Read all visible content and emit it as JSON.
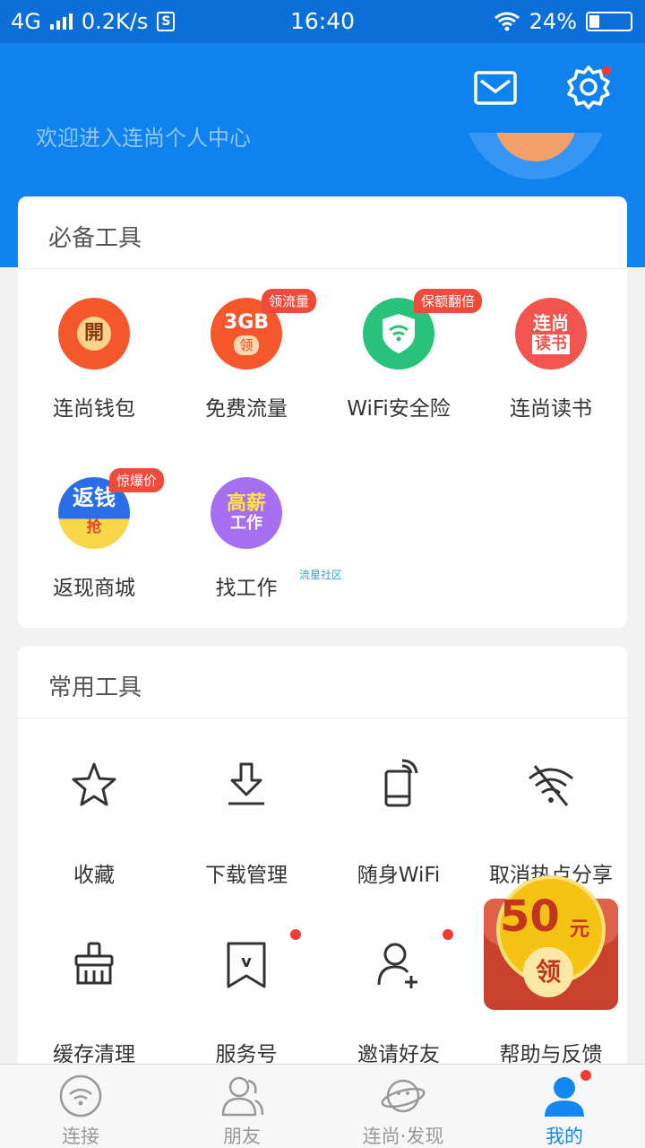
{
  "status_bar": {
    "network": "4G",
    "speed": "0.2K/s",
    "sim": "S",
    "time": "16:40",
    "battery": "24%",
    "battery_level": 0.24
  },
  "header": {
    "welcome": "欢迎进入连尚个人中心",
    "icons": [
      "mail-icon",
      "gear-icon"
    ],
    "colors": {
      "header_bg": "#0f82f0",
      "status_bg": "#0c6fd9"
    }
  },
  "essential_tools": {
    "title": "必备工具",
    "items": [
      {
        "label": "连尚钱包",
        "icon_text": "開",
        "tag": ""
      },
      {
        "label": "免费流量",
        "icon_text": "3GB",
        "icon_sub": "领",
        "tag": "领流量"
      },
      {
        "label": "WiFi安全险",
        "icon_text": "",
        "tag": "保额翻倍"
      },
      {
        "label": "连尚读书",
        "icon_text": "连尚",
        "icon_sub": "读书",
        "tag": ""
      },
      {
        "label": "返现商城",
        "icon_text": "返钱",
        "icon_sub": "抢",
        "tag": "惊爆价"
      },
      {
        "label": "找工作",
        "icon_text": "高薪",
        "icon_sub": "工作",
        "tag": ""
      }
    ]
  },
  "watermark": "流星社区",
  "common_tools": {
    "title": "常用工具",
    "items": [
      {
        "label": "收藏",
        "icon": "star-icon"
      },
      {
        "label": "下载管理",
        "icon": "download-icon"
      },
      {
        "label": "随身WiFi",
        "icon": "phone-wifi-icon"
      },
      {
        "label": "取消热点分享",
        "icon": "wifi-off-icon"
      },
      {
        "label": "缓存清理",
        "icon": "brush-icon"
      },
      {
        "label": "服务号",
        "icon": "service-icon",
        "icon_text": "v"
      },
      {
        "label": "邀请好友",
        "icon": "add-user-icon"
      },
      {
        "label": "帮助与反馈",
        "icon": "help-icon"
      }
    ]
  },
  "promo": {
    "amount": "50",
    "unit": "元",
    "action": "领"
  },
  "tabs": [
    {
      "label": "连接",
      "icon": "wifi-icon"
    },
    {
      "label": "朋友",
      "icon": "friends-icon"
    },
    {
      "label": "连尚·发现",
      "icon": "planet-icon"
    },
    {
      "label": "我的",
      "icon": "user-icon",
      "active": true
    }
  ]
}
